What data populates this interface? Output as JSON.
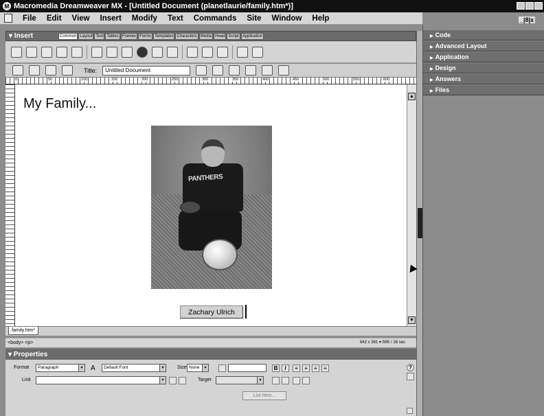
{
  "window": {
    "title": "Macromedia Dreamweaver MX - [Untitled Document (planetlaurie/family.htm*)]",
    "control_glyphs": "_|8|x"
  },
  "menubar": {
    "items": [
      "File",
      "Edit",
      "View",
      "Insert",
      "Modify",
      "Text",
      "Commands",
      "Site",
      "Window",
      "Help"
    ]
  },
  "insert_bar": {
    "label": "▾ Insert",
    "tabs": [
      "Common",
      "Layout",
      "Text",
      "Tables",
      "Frames",
      "Forms",
      "Templates",
      "Characters",
      "Media",
      "Head",
      "Script",
      "Application"
    ],
    "active_tab": "Common"
  },
  "document_toolbar": {
    "title_label": "Title:",
    "title_value": "Untitled Document"
  },
  "ruler": {
    "ticks": [
      "0",
      "50",
      "100",
      "150",
      "200",
      "250",
      "300",
      "350",
      "400",
      "450",
      "500",
      "550",
      "600"
    ]
  },
  "document": {
    "heading": "My Family...",
    "photo_jersey_text": "PANTHERS",
    "caption": "Zachary Ulrich"
  },
  "doc_tab": {
    "label": "family.htm*"
  },
  "status_bar": {
    "tag_selector": "<body> <p>",
    "size_info": "642 x 381 ▾  59K / 16 sec"
  },
  "properties": {
    "header": "▾ Properties",
    "format_label": "Format",
    "format_value": "Paragraph",
    "font_value": "Default Font",
    "size_label": "Size",
    "size_value": "None",
    "link_label": "Link",
    "target_label": "Target",
    "list_item_button": "List Item..."
  },
  "panels": [
    {
      "label": "Code"
    },
    {
      "label": "Advanced Layout"
    },
    {
      "label": "Application"
    },
    {
      "label": "Design"
    },
    {
      "label": "Answers"
    },
    {
      "label": "Files"
    }
  ],
  "icons": [
    "app-logo-icon",
    "document-icon",
    "hyperlink-icon",
    "email-link-icon",
    "named-anchor-icon",
    "table-icon",
    "layer-icon",
    "image-icon",
    "image-placeholder-icon",
    "rollover-image-icon",
    "flash-icon",
    "fireworks-html-icon",
    "navigation-bar-icon",
    "horizontal-rule-icon",
    "date-icon",
    "tabular-data-icon",
    "comment-icon",
    "tag-chooser-icon"
  ],
  "colors": {
    "titlebar": "#111111",
    "panel_header": "#6b6b6b",
    "panel_background": "#8c8c8c"
  }
}
